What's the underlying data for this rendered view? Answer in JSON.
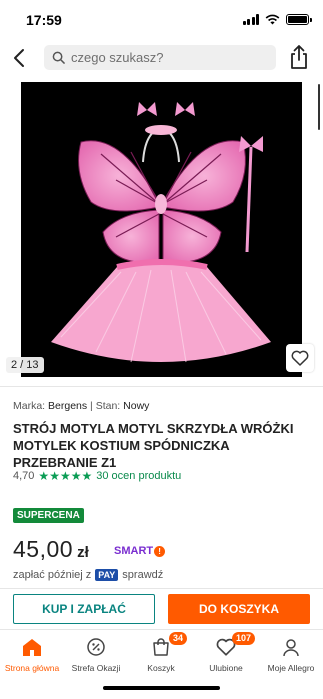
{
  "status_bar": {
    "time": "17:59"
  },
  "nav": {
    "search_placeholder": "czego szukasz?"
  },
  "gallery": {
    "counter": "2 / 13"
  },
  "meta": {
    "brand_label": "Marka:",
    "brand": "Bergens",
    "separator": "|",
    "state_label": "Stan:",
    "state": "Nowy"
  },
  "product": {
    "title": "STRÓJ MOTYLA MOTYL SKRZYDŁA WRÓŻKI MOTYLEK KOSTIUM SPÓDNICZKA PRZEBRANIE Z1",
    "rating_value": "4,70",
    "stars_filled": 5,
    "rating_count": "30 ocen produktu",
    "badge": "SUPERCENA",
    "price": "45,00",
    "currency": "zł",
    "smart_label": "SMART",
    "smart_dot": "!",
    "paylater_prefix": "zapłać później z",
    "paylater_brand": "PAY",
    "paylater_suffix": "sprawdź"
  },
  "actions": {
    "buy_now": "KUP I ZAPŁAĆ",
    "add_to_cart": "DO KOSZYKA"
  },
  "tabbar": {
    "items": [
      {
        "label": "Strona główna",
        "icon": "home-icon",
        "active": true
      },
      {
        "label": "Strefa Okazji",
        "icon": "deals-icon"
      },
      {
        "label": "Koszyk",
        "icon": "cart-icon",
        "badge": "34"
      },
      {
        "label": "Ulubione",
        "icon": "heart-icon",
        "badge": "107"
      },
      {
        "label": "Moje Allegro",
        "icon": "user-icon"
      }
    ]
  },
  "colors": {
    "accent": "#ff5a00",
    "teal": "#0a8480",
    "green": "#138a3a",
    "stars": "#0a9c54",
    "smart": "#7a2ed0"
  }
}
